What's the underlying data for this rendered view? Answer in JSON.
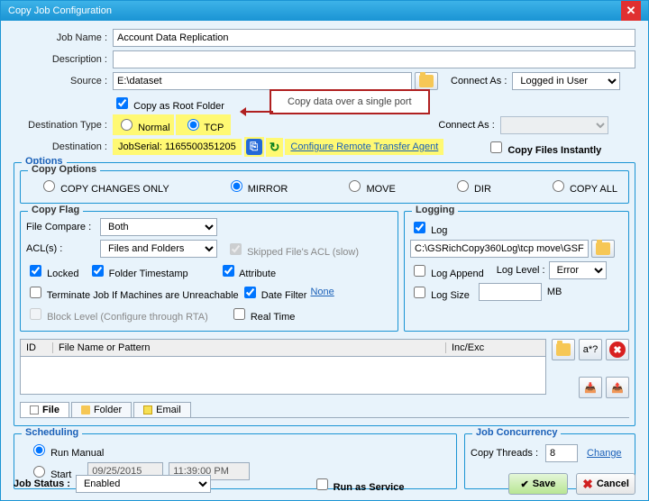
{
  "window": {
    "title": "Copy Job Configuration"
  },
  "labels": {
    "jobName": "Job Name :",
    "description": "Description :",
    "source": "Source :",
    "connectAs": "Connect As :",
    "copyAsRoot": "Copy as Root Folder",
    "destType": "Destination Type :",
    "normal": "Normal",
    "tcp": "TCP",
    "destination": "Destination :",
    "jobSerial": "JobSerial: 1165500351205",
    "configRemote": "Configure Remote Transfer Agent",
    "copyInstantly": "Copy Files Instantly",
    "options": "Options",
    "copyOptions": "Copy Options",
    "copyChanges": "COPY CHANGES ONLY",
    "mirror": "MIRROR",
    "move": "MOVE",
    "dir": "DIR",
    "copyAll": "COPY ALL",
    "copyFlag": "Copy Flag",
    "fileCompare": "File Compare :",
    "acls": "ACL(s) :",
    "skippedAcl": "Skipped File's ACL (slow)",
    "locked": "Locked",
    "folderTs": "Folder Timestamp",
    "attribute": "Attribute",
    "terminate": "Terminate Job If Machines are Unreachable",
    "dateFilter": "Date Filter",
    "none": "None",
    "blockLevel": "Block Level (Configure through RTA)",
    "realTime": "Real Time",
    "logging": "Logging",
    "log": "Log",
    "logAppend": "Log Append",
    "logLevel": "Log Level :",
    "logSize": "Log Size",
    "mb": "MB",
    "colId": "ID",
    "colFile": "File Name or Pattern",
    "colInc": "Inc/Exc",
    "tabFile": "File",
    "tabFolder": "Folder",
    "tabEmail": "Email",
    "scheduling": "Scheduling",
    "runManual": "Run Manual",
    "start": "Start",
    "jobConcur": "Job Concurrency",
    "copyThreads": "Copy Threads :",
    "change": "Change",
    "jobStatus": "Job Status :",
    "runService": "Run as Service",
    "save": "Save",
    "cancel": "Cancel",
    "hiddenPattern": "a*?"
  },
  "values": {
    "jobName": "Account Data Replication",
    "description": "",
    "source": "E:\\dataset",
    "connectAs1": "Logged in User",
    "connectAs2": "",
    "fileCompare": "Both",
    "acls": "Files and Folders",
    "logPath": "C:\\GSRichCopy360Log\\tcp move\\GSF",
    "logLevel": "Error",
    "logSize": "",
    "date": "09/25/2015",
    "time": "11:39:00 PM",
    "copyThreads": "8",
    "jobStatus": "Enabled"
  },
  "annotation": "Copy data over a single port"
}
